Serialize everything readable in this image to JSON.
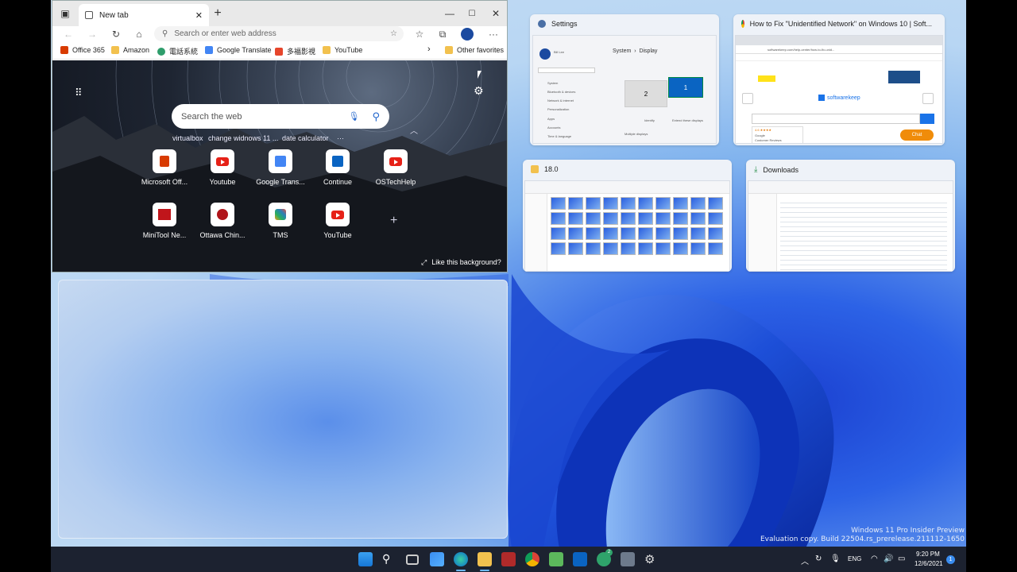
{
  "watermark": {
    "line1": "Windows 11 Pro Insider Preview",
    "line2": "Evaluation copy. Build 22504.rs_prerelease.211112-1650"
  },
  "edge": {
    "tab_title": "New tab",
    "address_placeholder": "Search or enter web address",
    "favorites": [
      {
        "label": "Office 365",
        "color": "#d83b01"
      },
      {
        "label": "Amazon",
        "color": "#f2c14e"
      },
      {
        "label": "電話系統",
        "color": "#2e9d6b"
      },
      {
        "label": "Google Translate",
        "color": "#4285f4"
      },
      {
        "label": "多福影視",
        "color": "#e6452b"
      },
      {
        "label": "YouTube",
        "color": "#f2c14e"
      }
    ],
    "other_favorites": "Other favorites",
    "search_placeholder": "Search the web",
    "quick_links": [
      "virtualbox",
      "change widnows 11 ...",
      "date calculator",
      "···"
    ],
    "tiles_row1": [
      "Microsoft Off...",
      "Youtube",
      "Google Trans...",
      "Continue",
      "OSTechHelp"
    ],
    "tiles_row2": [
      "MiniTool Ne...",
      "Ottawa Chin...",
      "TMS",
      "YouTube"
    ],
    "like_background": "Like this background?"
  },
  "snap": {
    "settings": {
      "title": "Settings",
      "breadcrumb": "System  ›  Display",
      "user": "Bill Lee",
      "nav": [
        "System",
        "Bluetooth & devices",
        "Network & internet",
        "Personalization",
        "Apps",
        "Accounts",
        "Time & language"
      ],
      "monitor1": "1",
      "monitor2": "2",
      "identify": "Identify",
      "extend": "Extend these displays",
      "multiple": "Multiple displays"
    },
    "chrome": {
      "title": "How to Fix \"Unidentified Network\" on Windows 10 | Soft...",
      "url": "softwarekeep.com/help-center/how-to-fix-unid...",
      "brand": "softwarekeep",
      "chat": "Chat",
      "rating": "4.6",
      "reviews_line1": "Google",
      "reviews_line2": "Customer Reviews"
    },
    "folder": {
      "title": "18.0"
    },
    "downloads": {
      "title": "Downloads"
    }
  },
  "taskbar": {
    "lang": "ENG",
    "time": "9:20 PM",
    "date": "12/6/2021",
    "notif": "1",
    "chat_badge": "2"
  },
  "colors": {
    "accent": "#0067c0",
    "taskbar": "#1c2230"
  }
}
